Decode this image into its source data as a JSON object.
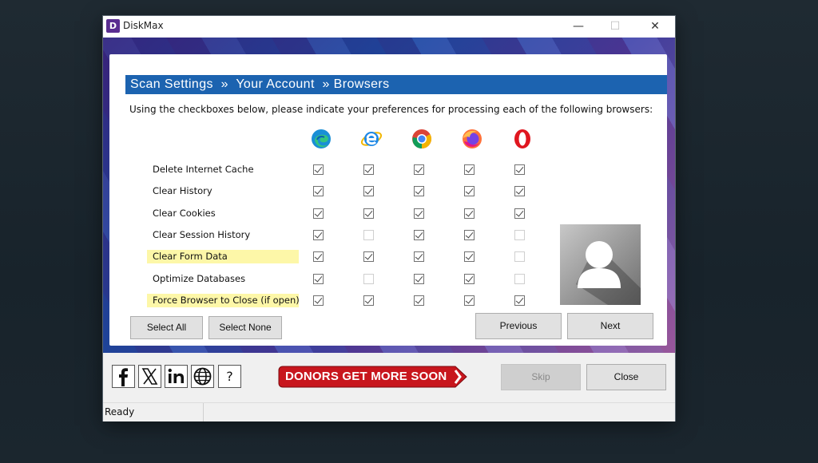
{
  "window": {
    "title": "DiskMax",
    "app_icon_letter": "D",
    "minimize": "—",
    "maximize": "☐",
    "close": "✕"
  },
  "header": {
    "breadcrumb": "Scan Settings  »  Your Account  » Browsers"
  },
  "instructions": "Using the checkboxes below, please indicate your preferences for processing each of the following browsers:",
  "browsers": [
    "edge-icon",
    "internet-explorer-icon",
    "chrome-icon",
    "firefox-icon",
    "opera-icon"
  ],
  "rows": [
    {
      "label": "Delete Internet Cache",
      "highlight": false,
      "checks": [
        1,
        1,
        1,
        1,
        1
      ]
    },
    {
      "label": "Clear History",
      "highlight": false,
      "checks": [
        1,
        1,
        1,
        1,
        1
      ]
    },
    {
      "label": "Clear Cookies",
      "highlight": false,
      "checks": [
        1,
        1,
        1,
        1,
        1
      ]
    },
    {
      "label": "Clear Session History",
      "highlight": false,
      "checks": [
        1,
        0,
        1,
        1,
        0
      ]
    },
    {
      "label": "Clear Form Data",
      "highlight": true,
      "checks": [
        1,
        1,
        1,
        1,
        0
      ]
    },
    {
      "label": "Optimize Databases",
      "highlight": false,
      "checks": [
        1,
        0,
        1,
        1,
        0
      ]
    },
    {
      "label": "Force Browser to Close (if open)",
      "highlight": true,
      "checks": [
        1,
        1,
        1,
        1,
        1
      ]
    }
  ],
  "buttons": {
    "select_all": "Select All",
    "select_none": "Select None",
    "previous": "Previous",
    "next": "Next",
    "skip": "Skip",
    "close": "Close"
  },
  "social": {
    "facebook": "f",
    "x": "𝕏",
    "linkedin": "in",
    "help": "?"
  },
  "donors_banner": "DONORS GET MORE SOON",
  "status": "Ready",
  "colors": {
    "header": "#1c63b0",
    "highlight": "#fdf7a8",
    "donors": "#c8161d"
  }
}
